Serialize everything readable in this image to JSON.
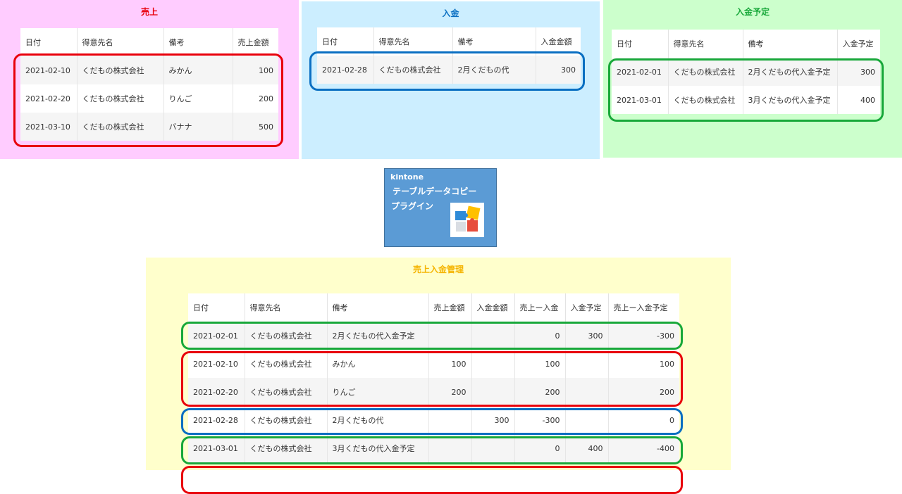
{
  "panels": {
    "sales": {
      "title": "売上",
      "title_color": "#e8000b",
      "bg": "#ffccff",
      "headers": [
        "日付",
        "得意先名",
        "備考",
        "売上金額"
      ],
      "rows": [
        [
          "2021-02-10",
          "くだもの株式会社",
          "みかん",
          "100"
        ],
        [
          "2021-02-20",
          "くだもの株式会社",
          "りんご",
          "200"
        ],
        [
          "2021-03-10",
          "くだもの株式会社",
          "バナナ",
          "500"
        ]
      ]
    },
    "deposit": {
      "title": "入金",
      "title_color": "#0a6fc2",
      "bg": "#cceeff",
      "headers": [
        "日付",
        "得意先名",
        "備考",
        "入金金額"
      ],
      "rows": [
        [
          "2021-02-28",
          "くだもの株式会社",
          "2月くだもの代",
          "300"
        ]
      ]
    },
    "schedule": {
      "title": "入金予定",
      "title_color": "#18a83a",
      "bg": "#ccffcc",
      "headers": [
        "日付",
        "得意先名",
        "備考",
        "入金予定"
      ],
      "rows": [
        [
          "2021-02-01",
          "くだもの株式会社",
          "2月くだもの代入金予定",
          "300"
        ],
        [
          "2021-03-01",
          "くだもの株式会社",
          "3月くだもの代入金予定",
          "400"
        ]
      ]
    },
    "summary": {
      "title": "売上入金管理",
      "title_color": "#f5b400",
      "bg": "#ffffcc",
      "headers": [
        "日付",
        "得意先名",
        "備考",
        "売上金額",
        "入金金額",
        "売上ー入金",
        "入金予定",
        "売上ー入金予定"
      ],
      "rows": [
        [
          "2021-02-01",
          "くだもの株式会社",
          "2月くだもの代入金予定",
          "",
          "",
          "0",
          "300",
          "-300"
        ],
        [
          "2021-02-10",
          "くだもの株式会社",
          "みかん",
          "100",
          "",
          "100",
          "",
          "100"
        ],
        [
          "2021-02-20",
          "くだもの株式会社",
          "りんご",
          "200",
          "",
          "200",
          "",
          "200"
        ],
        [
          "2021-02-28",
          "くだもの株式会社",
          "2月くだもの代",
          "",
          "300",
          "-300",
          "",
          "0"
        ],
        [
          "2021-03-01",
          "くだもの株式会社",
          "3月くだもの代入金予定",
          "",
          "",
          "0",
          "400",
          "-400"
        ]
      ]
    }
  },
  "plugin": {
    "brand": "kintone",
    "line1": "テーブルデータコピー",
    "line2": "プラグイン",
    "icon": "puzzle-icon"
  },
  "colors": {
    "sales": "#e8000b",
    "deposit": "#0a6fc2",
    "schedule": "#18a83a",
    "summary_title": "#f5b400"
  }
}
